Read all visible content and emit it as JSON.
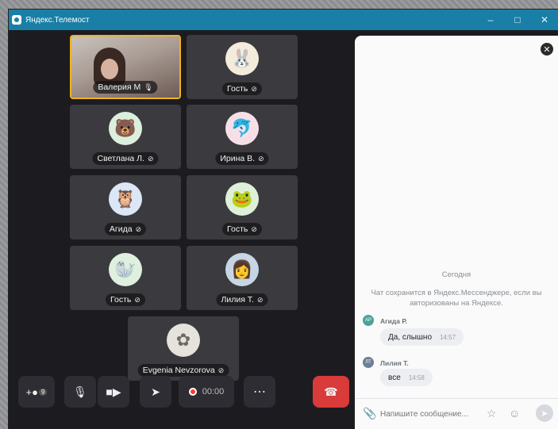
{
  "window": {
    "title": "Яндекс.Телемост",
    "minimize_icon": "minimize-icon",
    "maximize_icon": "maximize-icon",
    "close_icon": "close-icon"
  },
  "participants": [
    {
      "name": "Валерия М",
      "mic": "mic-on",
      "type": "video",
      "active": true
    },
    {
      "name": "Гость",
      "mic": "mic-off",
      "avatar_icon": "rabbit-icon",
      "avatar_bg": "#f3ecda",
      "glyph": "🐰"
    },
    {
      "name": "Светлана Л.",
      "mic": "mic-off",
      "avatar_icon": "bear-icon",
      "avatar_bg": "#dcefdc",
      "glyph": "🐻"
    },
    {
      "name": "Ирина В.",
      "mic": "mic-off",
      "avatar_icon": "dolphin-icon",
      "avatar_bg": "#f7dfe8",
      "glyph": "🐬"
    },
    {
      "name": "Агида",
      "mic": "mic-off",
      "avatar_icon": "owl-icon",
      "avatar_bg": "#dbe6f6",
      "glyph": "🦉"
    },
    {
      "name": "Гость",
      "mic": "mic-off",
      "avatar_icon": "frog-icon",
      "avatar_bg": "#def0d8",
      "glyph": "🐸"
    },
    {
      "name": "Гость",
      "mic": "mic-off",
      "avatar_icon": "walrus-icon",
      "avatar_bg": "#dff0de",
      "glyph": "🦭"
    },
    {
      "name": "Лилия Т.",
      "mic": "mic-off",
      "avatar_icon": "photo-avatar-icon",
      "avatar_bg": "#c7d6e4",
      "glyph": "👩"
    },
    {
      "name": "Evgenia Nevzorova",
      "mic": "mic-off",
      "avatar_icon": "photo-avatar-icon",
      "avatar_bg": "#e6e2dc",
      "glyph": "✿"
    }
  ],
  "toolbar": {
    "invite_icon": "add-participant-icon",
    "invite_badge": "9",
    "mic_icon": "microphone-icon",
    "camera_icon": "camera-icon",
    "share_icon": "share-screen-icon",
    "record_time": "00:00",
    "more_icon": "more-icon",
    "hangup_icon": "hangup-icon"
  },
  "chat": {
    "day": "Сегодня",
    "note": "Чат сохранится в Яндекс.Мессенджере, если вы авторизованы на Яндексе.",
    "messages": [
      {
        "initials": "АР",
        "author": "Агида Р.",
        "text": "Да, слышно",
        "time": "14:57",
        "avatar_color": "#4aa39a"
      },
      {
        "initials": "ЛТ",
        "author": "Лилия Т.",
        "text": "все",
        "time": "14:58",
        "avatar_color": "#6c7f94"
      }
    ],
    "placeholder": "Напишите сообщение...",
    "attach_icon": "paperclip-icon",
    "star_icon": "star-icon",
    "emoji_icon": "emoji-icon",
    "send_icon": "send-icon",
    "close_icon": "close-icon"
  }
}
